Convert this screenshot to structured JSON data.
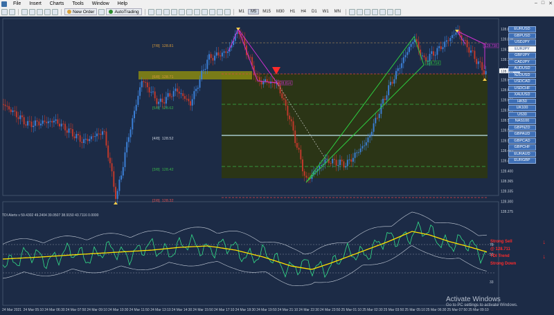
{
  "menu": {
    "items": [
      "File",
      "Insert",
      "Charts",
      "Tools",
      "Window",
      "Help"
    ],
    "window_buttons": [
      "–",
      "□",
      "✕"
    ]
  },
  "toolbar": {
    "new_order_label": "New Order",
    "autotrading_label": "AutoTrading",
    "timeframes": [
      "M1",
      "M5",
      "M15",
      "M30",
      "H1",
      "H4",
      "D1",
      "W1",
      "MN"
    ],
    "active_timeframe": "M5"
  },
  "symbols": {
    "items": [
      "EURUSD",
      "GBPUSD",
      "USDJPY",
      "EURJPY",
      "GBPJPY",
      "CADJPY",
      "AUDUSD",
      "NZDUSD",
      "USDCAD",
      "USDCHF",
      "XAUUSD",
      "HK50",
      "UK100",
      "US30",
      "NAS100",
      "GBPNZD",
      "GBPAUD",
      "GBPCAD",
      "GBPCHF",
      "EURAUD",
      "EURGBP"
    ],
    "active": "EURJPY"
  },
  "fib": {
    "levels": [
      {
        "label": "[7/8]",
        "value": "128.81",
        "color": "#d69a3b"
      },
      {
        "label": "[6/8]",
        "value": "128.71",
        "color": "#d69a3b"
      },
      {
        "label": "[5/8]",
        "value": "128.62",
        "color": "#39b54a"
      },
      {
        "label": "[4/8]",
        "value": "128.52",
        "color": "#c8d0dc"
      },
      {
        "label": "[3/8]",
        "value": "128.42",
        "color": "#39b54a"
      },
      {
        "label": "[2/8]",
        "value": "128.32",
        "color": "#e05050"
      }
    ]
  },
  "price_scale": [
    "128.860",
    "128.825",
    "128.795",
    "128.765",
    "128.730",
    "128.695",
    "128.665",
    "128.630",
    "128.595",
    "128.565",
    "128.530",
    "128.500",
    "128.465",
    "128.435",
    "128.400",
    "128.365",
    "128.335",
    "128.300",
    "128.275"
  ],
  "current_price": "128.711",
  "tags": {
    "tag1": "128.814",
    "tag2": "128.714",
    "tag3": "128.738",
    "tag4": "128.822"
  },
  "indicator": {
    "title": "TDI Alerts v 59.4302 49.2404 39.0507 38.9150 43.7116 0.0000",
    "levels": [
      "78",
      "50",
      "33"
    ],
    "alerts": [
      {
        "text": "Strong Sell"
      },
      {
        "text": "@ 128.711"
      },
      {
        "text": "TDI Trend"
      },
      {
        "text": "Strong Down"
      }
    ]
  },
  "time_axis": [
    "24 Mar 2021",
    "24 Mar 05:10",
    "24 Mar 06:30",
    "24 Mar 07:50",
    "24 Mar 09:10",
    "24 Mar 10:30",
    "24 Mar 11:50",
    "24 Mar 13:10",
    "24 Mar 14:30",
    "24 Mar 15:50",
    "24 Mar 17:10",
    "24 Mar 18:30",
    "24 Mar 19:50",
    "24 Mar 21:10",
    "24 Mar 22:30",
    "24 Mar 23:50",
    "25 Mar 01:10",
    "25 Mar 02:30",
    "25 Mar 03:50",
    "25 Mar 05:10",
    "25 Mar 06:30",
    "25 Mar 07:50",
    "25 Mar 09:10"
  ],
  "watermark": {
    "line1": "Activate Windows",
    "line2": "Go to PC settings to activate Windows."
  },
  "colors": {
    "background": "#1c2b46",
    "bull_candle": "#3b7fd6",
    "bear_candle": "#c0392b",
    "pattern_magenta": "#d030d0",
    "pattern_green": "#2ecc40",
    "zone_fill": "#2b3516",
    "tdi_green": "#33e08a",
    "tdi_yellow": "#ffe000"
  }
}
